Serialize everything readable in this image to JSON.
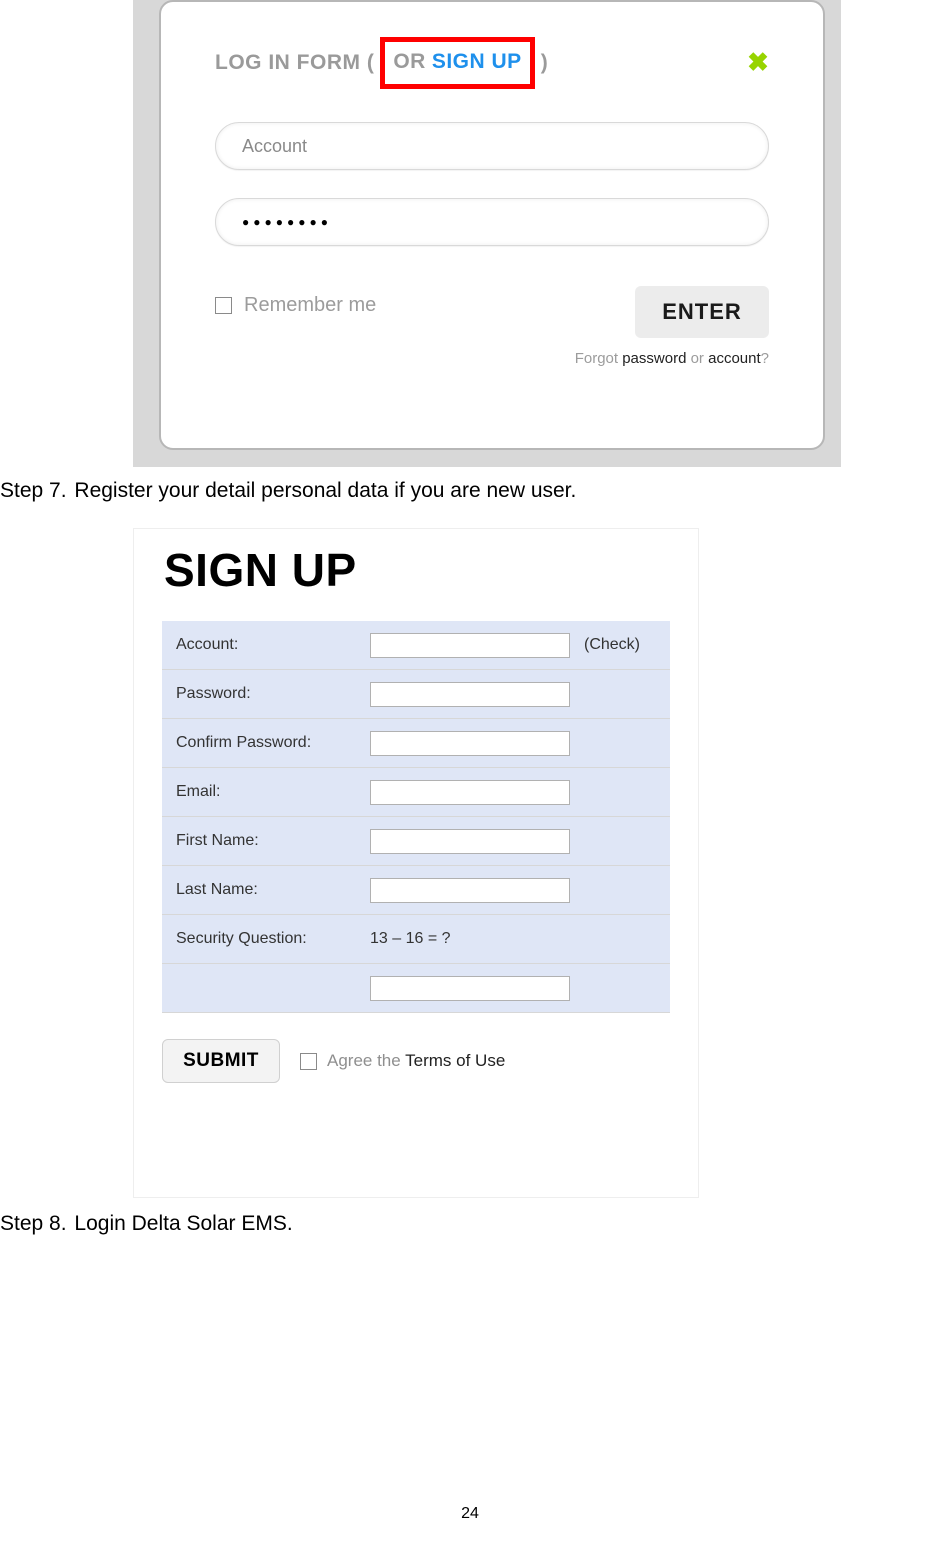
{
  "login": {
    "title_pre": "LOG IN FORM (",
    "or": "OR",
    "signup": "SIGN UP",
    "title_post": ")",
    "account_placeholder": "Account",
    "password_value": "●●●●●●●●",
    "remember": "Remember me",
    "enter": "ENTER",
    "forgot_pre": "Forgot ",
    "forgot_pw": "password",
    "forgot_mid": " or ",
    "forgot_acc": "account",
    "forgot_post": "?"
  },
  "step7": {
    "num": "Step 7.",
    "text": "Register your detail personal data if you are new user."
  },
  "signup": {
    "heading": "SIGN UP",
    "rows": {
      "account": "Account:",
      "check": "(Check)",
      "password": "Password:",
      "confirm": "Confirm Password:",
      "email": "Email:",
      "first": "First Name:",
      "last": "Last Name:",
      "secq": "Security Question:",
      "secq_val": "13 – 16 = ?"
    },
    "submit": "SUBMIT",
    "agree_pre": "Agree the ",
    "agree_terms": "Terms of Use"
  },
  "step8": {
    "num": "Step 8.",
    "text": "Login Delta Solar EMS."
  },
  "page_number": "24"
}
